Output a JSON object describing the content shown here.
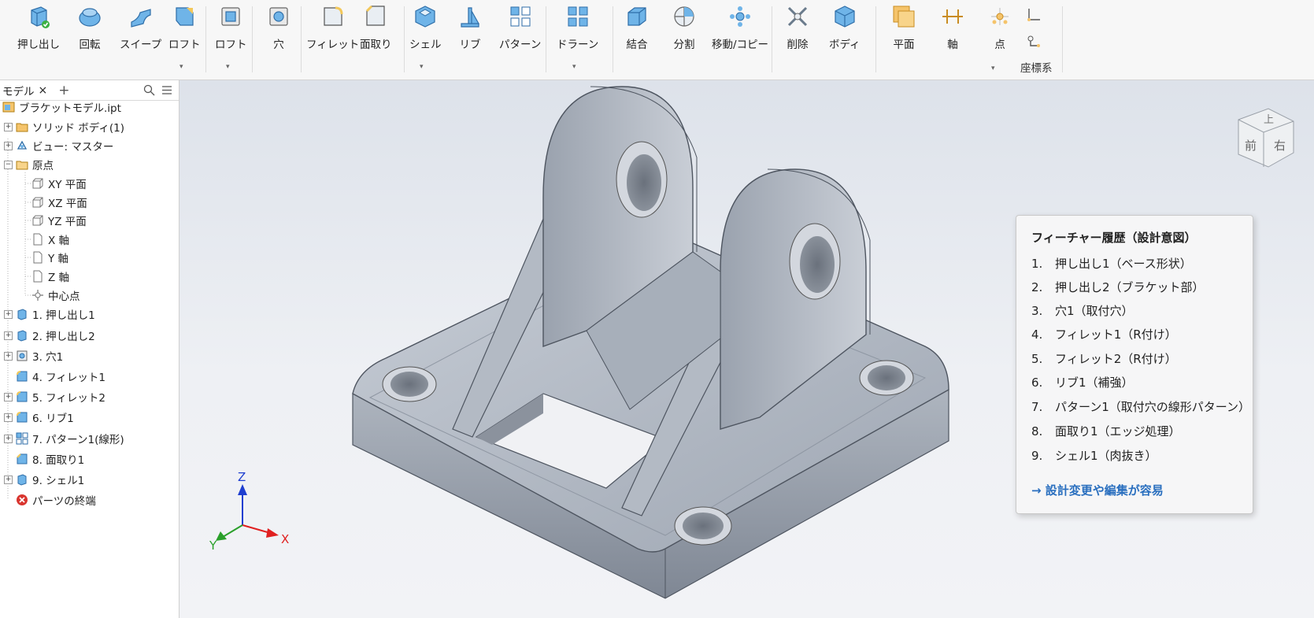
{
  "ribbon": {
    "buttons": [
      {
        "label": "押し出し",
        "icon": "extrude-icon"
      },
      {
        "label": "回転",
        "icon": "revolve-icon"
      },
      {
        "label": "スイープ",
        "icon": "sweep-icon"
      },
      {
        "label": "ロフト",
        "icon": "loft-icon"
      },
      {
        "label": "ロフト",
        "icon": "loft-2-icon"
      },
      {
        "label": "穴",
        "icon": "hole-icon"
      },
      {
        "label": "フィレット",
        "icon": "fillet-icon"
      },
      {
        "label": "面取り",
        "icon": "chamfer-icon"
      },
      {
        "label": "シェル",
        "icon": "shell-icon"
      },
      {
        "label": "リブ",
        "icon": "rib-icon"
      },
      {
        "label": "パターン",
        "icon": "pattern-icon"
      },
      {
        "label": "ドラーン",
        "icon": "draft-icon"
      },
      {
        "label": "結合",
        "icon": "combine-icon"
      },
      {
        "label": "分割",
        "icon": "split-icon"
      },
      {
        "label": "移動/コピー",
        "icon": "move-copy-icon"
      },
      {
        "label": "削除",
        "icon": "delete-icon"
      },
      {
        "label": "ボディ",
        "icon": "body-icon"
      },
      {
        "label": "平面",
        "icon": "plane-icon"
      },
      {
        "label": "軸",
        "icon": "axis-icon"
      },
      {
        "label": "点",
        "icon": "point-icon"
      }
    ],
    "group_label": "座標系"
  },
  "panel": {
    "tab_label": "モデル",
    "close": "×",
    "add": "+",
    "tree": [
      {
        "label": "ブラケットモデル.ipt",
        "icon": "part-file-icon"
      },
      {
        "label": "ソリッド ボディ(1)",
        "icon": "folder-icon"
      },
      {
        "label": "ビュー: マスター",
        "icon": "view-icon"
      },
      {
        "label": "原点",
        "icon": "folder-open-icon"
      },
      {
        "label": "XY 平面",
        "icon": "plane-small-icon"
      },
      {
        "label": "XZ 平面",
        "icon": "plane-small-icon"
      },
      {
        "label": "YZ 平面",
        "icon": "plane-small-icon"
      },
      {
        "label": "X 軸",
        "icon": "axis-small-icon"
      },
      {
        "label": "Y 軸",
        "icon": "axis-small-icon"
      },
      {
        "label": "Z 軸",
        "icon": "axis-small-icon"
      },
      {
        "label": "中心点",
        "icon": "center-point-icon"
      },
      {
        "label": "1. 押し出し1",
        "icon": "extrude-small-icon"
      },
      {
        "label": "2. 押し出し2",
        "icon": "extrude-small-icon"
      },
      {
        "label": "3. 穴1",
        "icon": "hole-small-icon"
      },
      {
        "label": "4. フィレット1",
        "icon": "fillet-small-icon"
      },
      {
        "label": "5. フィレット2",
        "icon": "fillet-small-icon"
      },
      {
        "label": "6. リブ1",
        "icon": "rib-small-icon"
      },
      {
        "label": "7. パターン1(線形)",
        "icon": "pattern-small-icon"
      },
      {
        "label": "8. 面取り1",
        "icon": "chamfer-small-icon"
      },
      {
        "label": "9. シェル1",
        "icon": "shell-small-icon"
      },
      {
        "label": "パーツの終端",
        "icon": "end-of-part-icon"
      }
    ]
  },
  "viewcube": {
    "top": "上",
    "front": "前",
    "right": "右"
  },
  "triad": {
    "x": "X",
    "y": "Y",
    "z": "Z",
    "x_color": "#e02020",
    "y_color": "#2aa02a",
    "z_color": "#1f3fd0"
  },
  "feature_history": {
    "title": "フィーチャー履歴（設計意図）",
    "items": [
      {
        "num": "1.",
        "text": "押し出し1（ベース形状）"
      },
      {
        "num": "2.",
        "text": "押し出し2（ブラケット部）"
      },
      {
        "num": "3.",
        "text": "穴1（取付穴）"
      },
      {
        "num": "4.",
        "text": "フィレット1（R付け）"
      },
      {
        "num": "5.",
        "text": "フィレット2（R付け）"
      },
      {
        "num": "6.",
        "text": "リブ1（補強）"
      },
      {
        "num": "7.",
        "text": "パターン1（取付穴の線形パターン）"
      },
      {
        "num": "8.",
        "text": "面取り1（エッジ処理）"
      },
      {
        "num": "9.",
        "text": "シェル1（肉抜き）"
      }
    ],
    "footer": "→  設計変更や編集が容易",
    "footer_color": "#2a6fbf"
  }
}
